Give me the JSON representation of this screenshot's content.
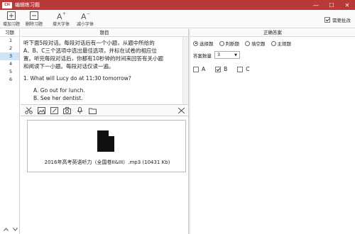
{
  "window": {
    "title": "编辑练习题",
    "app_icon_text": "CH",
    "titlebar_color": "#b83a38",
    "min_glyph": "—",
    "max_glyph": "☐",
    "close_glyph": "✕"
  },
  "toolbar": {
    "add_label": "增加习题",
    "delete_label": "删除习题",
    "font_up_label": "增大字体",
    "font_down_label": "减小字体",
    "review_label": "需要批改",
    "review_checked": true
  },
  "question_list": {
    "header": "习题",
    "items": [
      "1",
      "2",
      "3",
      "4",
      "5",
      "6"
    ],
    "selected_index": 2
  },
  "question": {
    "header": "题目",
    "lines": [
      "听下面5段对话。每段对话后有一个小题，从题中所给的",
      "A、B、C三个选项中选出最佳选项，并标在试卷的相应位",
      "置。听完每段对话后，你都有10秒钟的时间来回答有关小题",
      "和阅读下一小题。每段对话仅读一遍。"
    ],
    "prompt": "1. What will Lucy do at 11:30 tomorrow?",
    "options": [
      "A. Go out for lunch.",
      "B. See her dentist."
    ]
  },
  "attachment": {
    "tools": [
      "scissors-icon",
      "image-icon",
      "edit-image-icon",
      "camera-icon",
      "audio-icon",
      "folder-icon"
    ],
    "clear_glyph": "✕",
    "file_name": "2016年高考英语听力（全国卷II&III）.mp3 (10431 Kb)"
  },
  "answer": {
    "header": "正确答案",
    "types": [
      {
        "label": "选择题",
        "selected": true
      },
      {
        "label": "判断题",
        "selected": false
      },
      {
        "label": "填空题",
        "selected": false
      },
      {
        "label": "主观题",
        "selected": false
      }
    ],
    "count_label": "答案数量",
    "count_value": "3",
    "choices": [
      {
        "label": "A",
        "checked": false
      },
      {
        "label": "B",
        "checked": true
      },
      {
        "label": "C",
        "checked": false
      }
    ]
  }
}
